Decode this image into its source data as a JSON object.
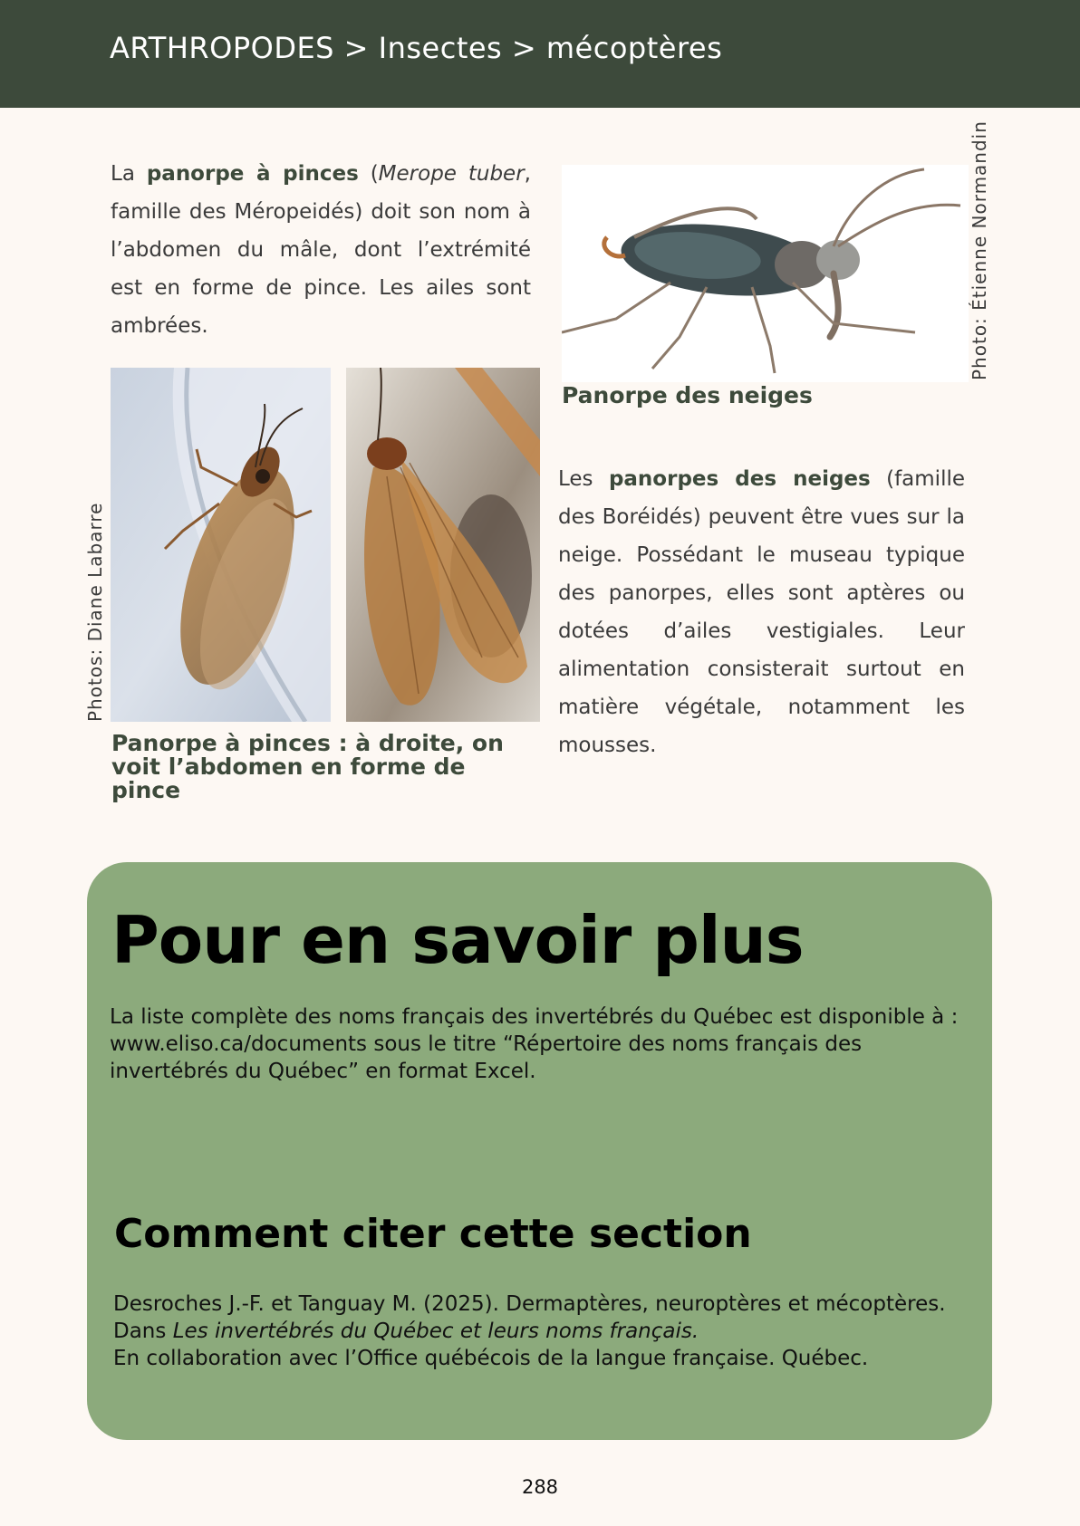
{
  "breadcrumb": "ARTHROPODES > Insectes > mécoptères",
  "section1": {
    "t1": "La ",
    "bold": "panorpe à pinces",
    "t2": " (",
    "italic": "Merope tuber",
    "t3": ", famille des Méropeidés) doit son nom à l’abdomen du mâle, dont l’extrémité est en forme de pince. Les ailes sont ambrées."
  },
  "photos_left": {
    "credit": "Photos: Diane Labarre",
    "caption": "Panorpe à pinces : à droite, on voit l’abdomen en forme de pince"
  },
  "photo_right": {
    "credit": "Photo: Étienne Normandin",
    "caption": "Panorpe des neiges"
  },
  "section2": {
    "t1": "Les ",
    "bold": "panorpes des neiges",
    "t2": " (famille des Boréidés) peuvent être vues sur la neige. Possédant le museau typique des panorpes, elles sont aptères ou dotées d’ailes vestigiales. Leur alimentation consisterait surtout en matière végétale, notamment les mousses."
  },
  "info_box": {
    "title": "Pour en savoir plus",
    "text": "La liste complète des noms français des invertébrés du Québec est disponible à : www.eliso.ca/documents sous le titre “Répertoire des noms français des invertébrés du Québec” en format Excel.",
    "cite_title": "Comment citer cette section",
    "cite_t1": "Desroches J.-F. et Tanguay M. (2025). Dermaptères, neuroptères et mécoptères. Dans ",
    "cite_italic": "Les invertébrés du Québec et leurs noms français.",
    "cite_t2": "En collaboration avec l’Office québécois de la langue française. Québec.",
    "colors": {
      "box": "#8caa7c",
      "header": "#3d4a3b"
    }
  },
  "page_number": "288"
}
